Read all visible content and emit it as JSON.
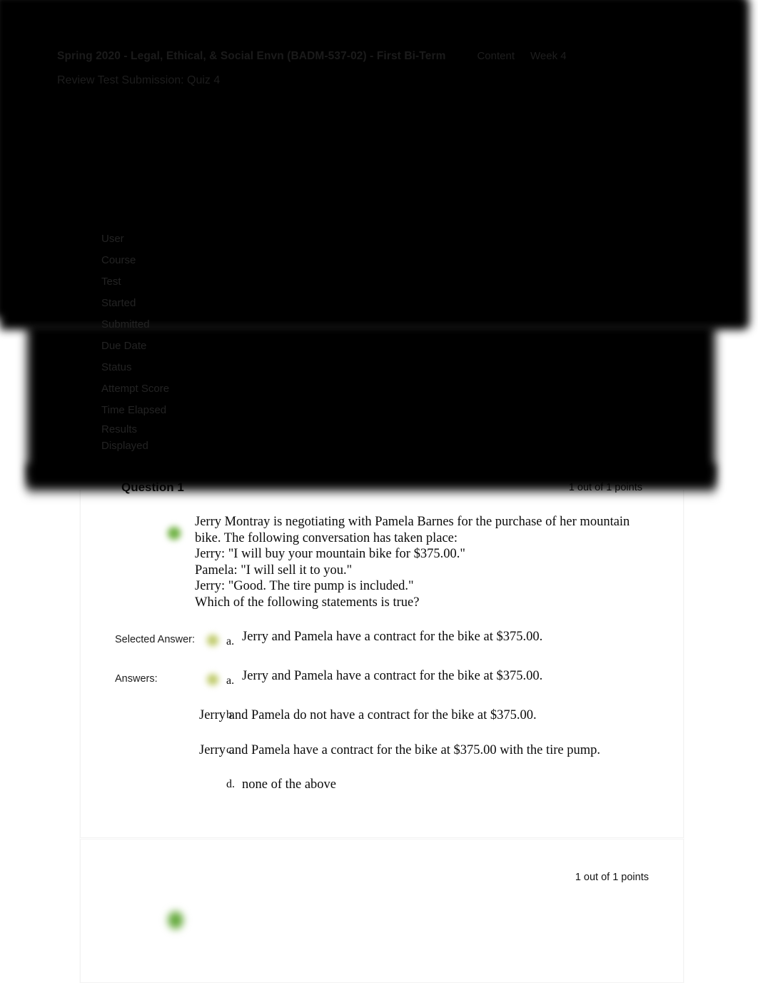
{
  "header": {
    "course_title": "Spring 2020 - Legal, Ethical, & Social Envn (BADM-537-02) - First Bi-Term",
    "breadcrumbs": [
      "Content",
      "Week 4"
    ],
    "page_heading": "Review Test Submission: Quiz 4"
  },
  "attempt_details": {
    "labels": [
      "User",
      "Course",
      "Test",
      "Started",
      "Submitted",
      "Due Date",
      "Status",
      "Attempt Score",
      "Time Elapsed"
    ],
    "results_displayed_line1": "Results",
    "results_displayed_line2": "Displayed"
  },
  "questions": [
    {
      "title": "Question 1",
      "points": "1 out of 1 points",
      "text": "Jerry Montray is negotiating with Pamela Barnes for the purchase of her mountain bike. The following conversation has taken place:\nJerry: \"I will buy your mountain bike for $375.00.\"\nPamela: \"I will sell it to you.\"\nJerry: \"Good. The tire pump is included.\"\nWhich of the following statements is true?",
      "selected_answer_label": "Selected Answer:",
      "answers_label": "Answers:",
      "selected_answer": {
        "letter": "a.",
        "text": "Jerry and Pamela have a contract for the bike at $375.00."
      },
      "options": [
        {
          "letter": "a.",
          "text": "Jerry and Pamela have a contract for the bike at $375.00.",
          "correct": true,
          "inline": true
        },
        {
          "letter": "b.",
          "text": "Jerry and Pamela do not have a contract for the bike at $375.00.",
          "correct": false,
          "inline": false
        },
        {
          "letter": "c.",
          "text": "Jerry and Pamela have a contract for the bike at $375.00 with the tire pump.",
          "correct": false,
          "inline": false
        },
        {
          "letter": "d.",
          "text": "none of the above",
          "correct": false,
          "inline": true
        }
      ]
    },
    {
      "title": "",
      "points": "1 out of 1 points",
      "text": ""
    }
  ],
  "colors": {
    "correct_marker": "#5aa830",
    "option_marker": "#b5c258",
    "redaction": "#000000",
    "page_background": "#ffffff"
  }
}
